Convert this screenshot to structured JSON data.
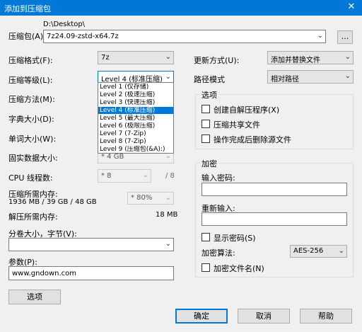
{
  "window": {
    "title": "添加到压缩包",
    "close_glyph": "✕"
  },
  "archive": {
    "label": "压缩包(A):",
    "path": "D:\\Desktop\\",
    "filename": "7z24.09-zstd-x64.7z",
    "browse_label": "..."
  },
  "left": {
    "format_label": "压缩格式(F):",
    "format_value": "7z",
    "level_label": "压缩等级(L):",
    "level_value": "Level 4 (标准压缩)",
    "method_label": "压缩方法(M):",
    "dict_label": "字典大小(D):",
    "word_label": "单词大小(W):",
    "solid_label": "固实数据大小:",
    "solid_value": "* 4 GB",
    "cpu_label": "CPU 线程数:",
    "cpu_value": "* 8",
    "cpu_total": "/ 8",
    "mem_comp_label": "压缩所需内存:",
    "mem_comp_value": "1936 MB / 39 GB / 48 GB",
    "mem_percent": "* 80%",
    "mem_decomp_label": "解压所需内存:",
    "mem_decomp_value": "18 MB",
    "split_label": "分卷大小，字节(V):",
    "split_value": "",
    "params_label": "参数(P):",
    "params_value": "www.gndown.com",
    "options_button": "选项"
  },
  "level_dropdown": [
    {
      "label": "Level 1 (仅存储)"
    },
    {
      "label": "Level 2 (极速压缩)"
    },
    {
      "label": "Level 3 (快速压缩)"
    },
    {
      "label": "Level 4 (标准压缩)"
    },
    {
      "label": "Level 5 (最大压缩)"
    },
    {
      "label": "Level 6 (极限压缩)"
    },
    {
      "label": "Level 7 (7-Zip)"
    },
    {
      "label": "Level 8 (7-Zip)"
    },
    {
      "label": "Level 9 (压缩包(&A):)"
    }
  ],
  "right": {
    "update_label": "更新方式(U):",
    "update_value": "添加并替换文件",
    "path_label": "路径模式",
    "path_value": "相对路径",
    "options_group": "选项",
    "opt_sfx": "创建自解压程序(X)",
    "opt_shared": "压缩共享文件",
    "opt_delete": "操作完成后删除源文件",
    "encrypt_group": "加密",
    "pw_label": "输入密码:",
    "pw_value": "",
    "pw2_label": "重新输入:",
    "pw2_value": "",
    "show_pw": "显示密码(S)",
    "enc_method_label": "加密算法:",
    "enc_method_value": "AES-256",
    "enc_names": "加密文件名(N)"
  },
  "buttons": {
    "ok": "确定",
    "cancel": "取消",
    "help": "帮助"
  }
}
